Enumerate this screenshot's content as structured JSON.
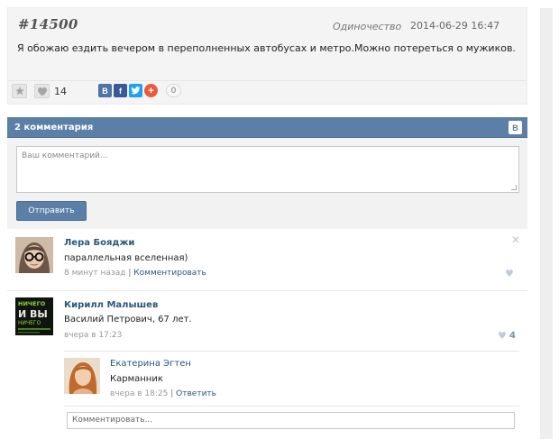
{
  "post": {
    "number": "#14500",
    "category": "Одиночество",
    "date": "2014-06-29 16:47",
    "text": "Я обожаю ездить вечером в переполненных автобусах и метро.Можно потереться о мужиков.",
    "votes": "14",
    "share_count": "0",
    "share_icons": {
      "vk": "В",
      "fb": "f",
      "more": "+"
    }
  },
  "comments": {
    "title": "2 комментария",
    "badge": "В",
    "input_placeholder": "Ваш комментарий...",
    "submit_label": "Отправить",
    "items": [
      {
        "author": "Лера Бояджи",
        "text": "параллельная вселенная)",
        "time": "8 минут назад",
        "separator": "|",
        "action": "Комментировать"
      },
      {
        "author": "Кирилл Малышев",
        "text": "Василий Петрович, 67 лет.",
        "time": "вчера в 17:23",
        "likes": "4",
        "avatar_text": [
          "НИЧЕГО",
          "И ВЫ",
          "НИЧЕГО"
        ],
        "replies": [
          {
            "author": "Екатерина Эгтен",
            "text": "Карманник",
            "time": "вчера в 18:25",
            "separator": "|",
            "action": "Ответить"
          }
        ]
      }
    ],
    "reply_placeholder": "Комментировать..."
  },
  "colors": {
    "accent": "#5b7fa6",
    "link": "#2b587a"
  }
}
